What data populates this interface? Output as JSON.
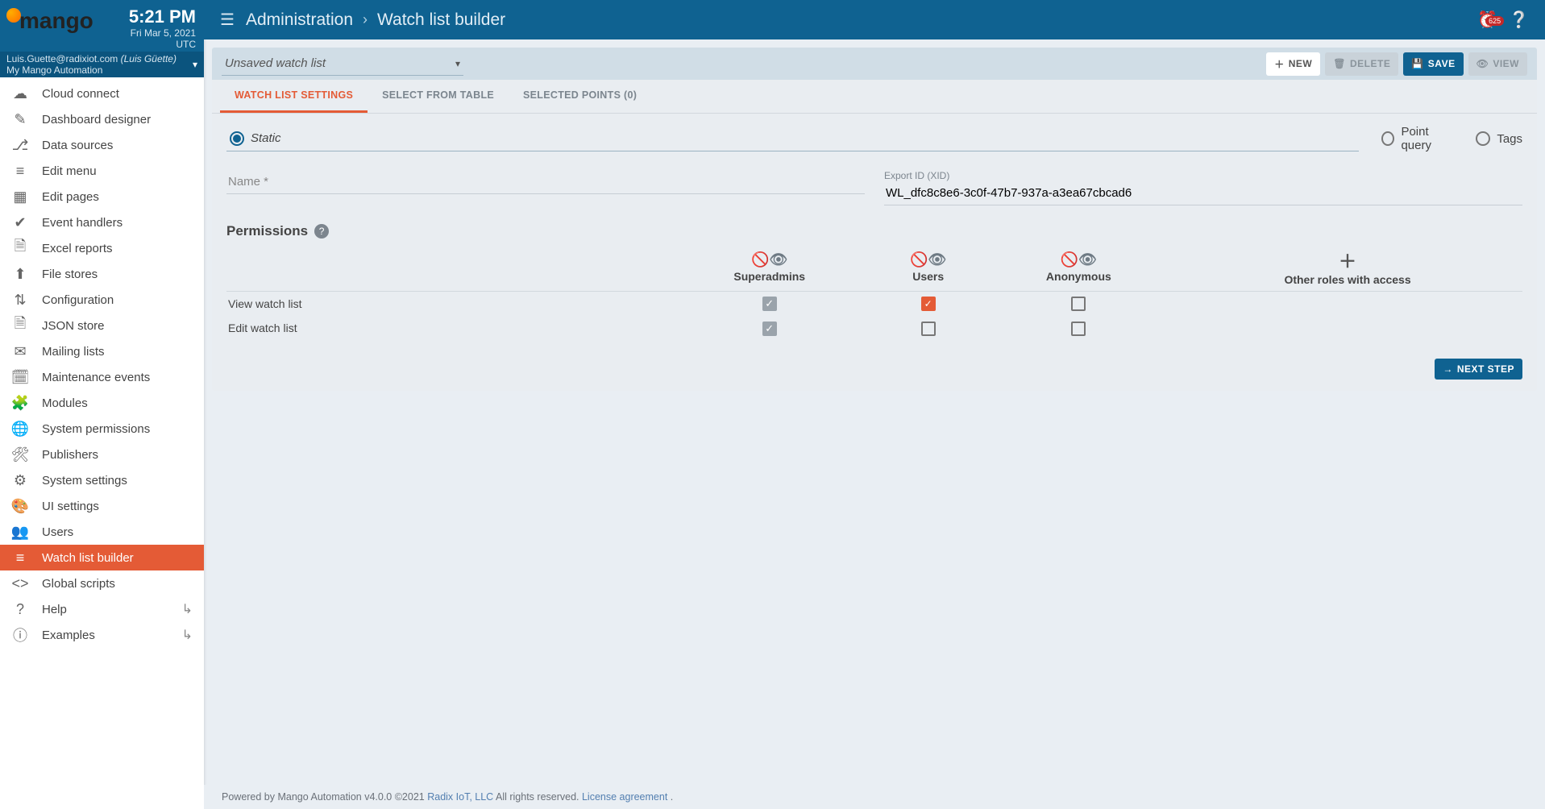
{
  "brand": "mango",
  "clock": {
    "time": "5:21 PM",
    "date": "Fri Mar 5, 2021",
    "tz": "UTC"
  },
  "user": {
    "email": "Luis.Guette@radixiot.com",
    "name": "(Luis Güette)",
    "app": "My Mango Automation"
  },
  "nav": [
    {
      "icon": "☁",
      "label": "Cloud connect"
    },
    {
      "icon": "✎",
      "label": "Dashboard designer"
    },
    {
      "icon": "⎇",
      "label": "Data sources"
    },
    {
      "icon": "≡",
      "label": "Edit menu"
    },
    {
      "icon": "▦",
      "label": "Edit pages"
    },
    {
      "icon": "✔",
      "label": "Event handlers"
    },
    {
      "icon": "🗎",
      "label": "Excel reports"
    },
    {
      "icon": "⬆",
      "label": "File stores"
    },
    {
      "icon": "⇅",
      "label": "Configuration"
    },
    {
      "icon": "🗎",
      "label": "JSON store"
    },
    {
      "icon": "✉",
      "label": "Mailing lists"
    },
    {
      "icon": "🗓",
      "label": "Maintenance events"
    },
    {
      "icon": "🧩",
      "label": "Modules"
    },
    {
      "icon": "🌐",
      "label": "System permissions"
    },
    {
      "icon": "🛠",
      "label": "Publishers"
    },
    {
      "icon": "⚙",
      "label": "System settings"
    },
    {
      "icon": "🎨",
      "label": "UI settings"
    },
    {
      "icon": "👥",
      "label": "Users"
    },
    {
      "icon": "≡",
      "label": "Watch list builder",
      "active": true
    },
    {
      "icon": "<>",
      "label": "Global scripts"
    },
    {
      "icon": "?",
      "label": "Help",
      "expand": true
    },
    {
      "icon": "ⓘ",
      "label": "Examples",
      "expand": true
    }
  ],
  "bc": {
    "a": "Administration",
    "b": "Watch list builder"
  },
  "notif": "625",
  "dropdown": "Unsaved watch list",
  "buttons": {
    "new": "NEW",
    "delete": "DELETE",
    "save": "SAVE",
    "view": "VIEW"
  },
  "tabs": {
    "a": "WATCH LIST SETTINGS",
    "b": "SELECT FROM TABLE",
    "c": "SELECTED POINTS (0)"
  },
  "radios": {
    "static": "Static",
    "pq": "Point query",
    "tags": "Tags"
  },
  "fields": {
    "name_label": "Name *",
    "xid_label": "Export ID (XID)",
    "xid": "WL_dfc8c8e6-3c0f-47b7-937a-a3ea67cbcad6"
  },
  "perm": {
    "title": "Permissions",
    "cols": {
      "sa": "Superadmins",
      "u": "Users",
      "an": "Anonymous",
      "oth": "Other roles with access"
    },
    "rows": {
      "view": "View watch list",
      "edit": "Edit watch list"
    }
  },
  "next": "NEXT STEP",
  "footer": {
    "pre": "Powered by Mango Automation v4.0.0 ©2021 ",
    "link1": "Radix IoT, LLC",
    "mid": " All rights reserved. ",
    "link2": "License agreement",
    "end": "."
  }
}
